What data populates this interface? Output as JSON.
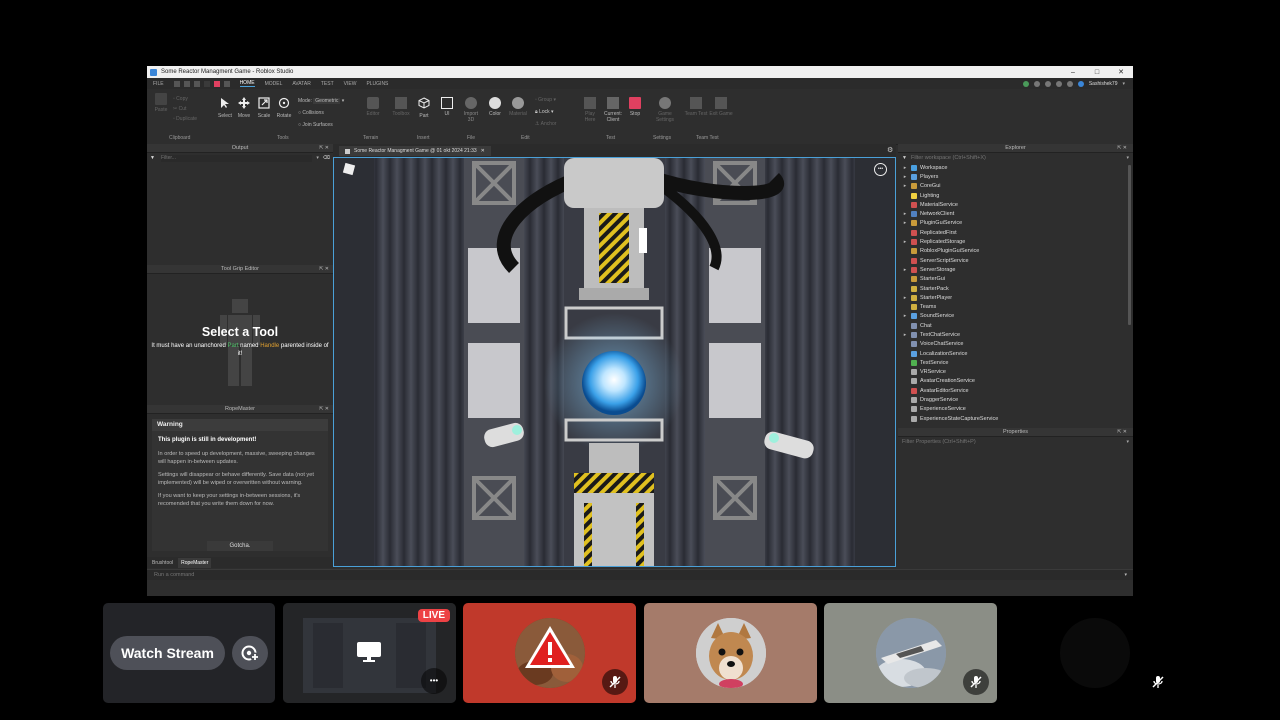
{
  "window": {
    "title": "Some Reactor Managment Game - Roblox Studio",
    "user": "Sashishek79"
  },
  "menu": {
    "file": "FILE",
    "tabs": [
      "HOME",
      "MODEL",
      "AVATAR",
      "TEST",
      "VIEW",
      "PLUGINS"
    ]
  },
  "ribbon": {
    "clipboard_items": [
      "Copy",
      "Cut",
      "Duplicate"
    ],
    "paste": "Paste",
    "tools": [
      "Select",
      "Move",
      "Scale",
      "Rotate"
    ],
    "mode_label": "Mode:",
    "mode_value": "Geometric",
    "collisions": "Collisions",
    "join_surfaces": "Join Surfaces",
    "editor": "Editor",
    "toolbox": "Toolbox",
    "part": "Part",
    "ui": "UI",
    "import_3d": "Import 3D",
    "color": "Color",
    "material": "Material",
    "group": "Group",
    "lock": "Lock",
    "anchor": "Anchor",
    "play_here": "Play Here",
    "current_client": "Current: Client",
    "stop": "Stop",
    "game_settings": "Game Settings",
    "team_test": "Team Test",
    "exit_game": "Exit Game",
    "groups": {
      "clipboard": "Clipboard",
      "tools": "Tools",
      "terrain": "Terrain",
      "insert": "Insert",
      "file": "File",
      "edit": "Edit",
      "test": "Test",
      "settings": "Settings",
      "team_test": "Team Test"
    }
  },
  "output": {
    "title": "Output",
    "filter_placeholder": "Filter..."
  },
  "tool_grip": {
    "title": "Tool Grip Editor",
    "heading": "Select a Tool",
    "msg_a": "It must have an unanchored ",
    "msg_part": "Part",
    "msg_b": " named ",
    "msg_handle": "Handle",
    "msg_c": " parented inside of it!"
  },
  "ropemaster": {
    "title": "RopeMaster",
    "warning": "Warning",
    "headline": "This plugin is still in development!",
    "p1": "In order to speed up development, massive, sweeping changes will happen in-between updates.",
    "p2": "Settings will disappear or behave differently. Save data (not yet implemented) will be wiped or overwritten without warning.",
    "p3": "If you want to keep your settings in-between sessions, it's recomended that you write them down for now.",
    "button": "Gotcha."
  },
  "bottom_tabs": [
    "Brushtool",
    "RopeMaster"
  ],
  "viewport_tab": "Some Reactor Managment Game @ 01 okt 2024 21:33",
  "explorer": {
    "title": "Explorer",
    "filter_placeholder": "Filter workspace (Ctrl+Shift+X)",
    "items": [
      {
        "name": "Workspace",
        "arrow": true,
        "color": "#4aa0e0"
      },
      {
        "name": "Players",
        "arrow": true,
        "color": "#5aa0e0"
      },
      {
        "name": "CoreGui",
        "arrow": true,
        "color": "#c89a3a"
      },
      {
        "name": "Lighting",
        "arrow": false,
        "color": "#f0d040"
      },
      {
        "name": "MaterialService",
        "arrow": false,
        "color": "#d05050"
      },
      {
        "name": "NetworkClient",
        "arrow": true,
        "color": "#5080c0"
      },
      {
        "name": "PluginGuiService",
        "arrow": true,
        "color": "#c89a3a"
      },
      {
        "name": "ReplicatedFirst",
        "arrow": false,
        "color": "#d05050"
      },
      {
        "name": "ReplicatedStorage",
        "arrow": true,
        "color": "#d05050"
      },
      {
        "name": "RobloxPluginGuiService",
        "arrow": false,
        "color": "#c89a3a"
      },
      {
        "name": "ServerScriptService",
        "arrow": false,
        "color": "#d05050"
      },
      {
        "name": "ServerStorage",
        "arrow": true,
        "color": "#d05050"
      },
      {
        "name": "StarterGui",
        "arrow": false,
        "color": "#c89a3a"
      },
      {
        "name": "StarterPack",
        "arrow": false,
        "color": "#d0b040"
      },
      {
        "name": "StarterPlayer",
        "arrow": true,
        "color": "#d0b040"
      },
      {
        "name": "Teams",
        "arrow": false,
        "color": "#d0b040"
      },
      {
        "name": "SoundService",
        "arrow": true,
        "color": "#5aa0e0"
      },
      {
        "name": "Chat",
        "arrow": false,
        "color": "#8090b0"
      },
      {
        "name": "TextChatService",
        "arrow": true,
        "color": "#8090b0"
      },
      {
        "name": "VoiceChatService",
        "arrow": false,
        "color": "#8090b0"
      },
      {
        "name": "LocalizationService",
        "arrow": false,
        "color": "#5aa0e0"
      },
      {
        "name": "TestService",
        "arrow": false,
        "color": "#50b050"
      },
      {
        "name": "VRService",
        "arrow": false,
        "color": "#aaaaaa"
      },
      {
        "name": "AvatarCreationService",
        "arrow": false,
        "color": "#aaaaaa"
      },
      {
        "name": "AvatarEditorService",
        "arrow": false,
        "color": "#d05050"
      },
      {
        "name": "DraggerService",
        "arrow": false,
        "color": "#aaaaaa"
      },
      {
        "name": "ExperienceService",
        "arrow": false,
        "color": "#aaaaaa"
      },
      {
        "name": "ExperienceStateCaptureService",
        "arrow": false,
        "color": "#aaaaaa"
      }
    ]
  },
  "properties": {
    "title": "Properties",
    "filter_placeholder": "Filter Properties (Ctrl+Shift+P)"
  },
  "command_bar": {
    "placeholder": "Run a command"
  },
  "call": {
    "watch_stream": "Watch Stream",
    "live": "LIVE",
    "more": "•••"
  },
  "colors": {
    "accent": "#4aa0d8",
    "live_red": "#ed4245",
    "tile_red": "#c0392b",
    "tile_brown": "#a57b6a",
    "tile_gray": "#8b8e86"
  }
}
